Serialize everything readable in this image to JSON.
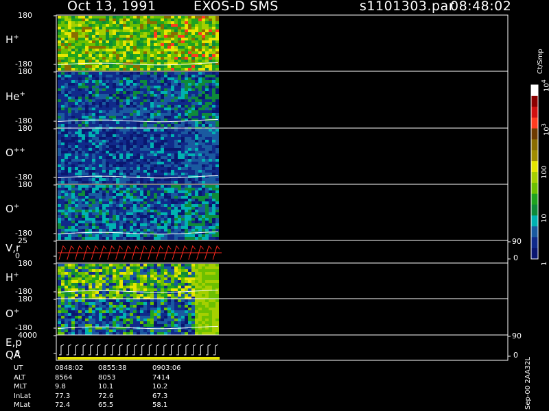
{
  "header": {
    "date": "Oct 13, 1991",
    "instrument": "EXOS-D SMS",
    "file": "s1101303.par",
    "time": "08:48:02"
  },
  "panels": [
    {
      "id": "h_plus_1",
      "label_base": "H",
      "label_sup": "+",
      "y_top": "180",
      "y_bottom": "-180"
    },
    {
      "id": "he_plus",
      "label_base": "He",
      "label_sup": "+",
      "y_top": "180",
      "y_bottom": "-180"
    },
    {
      "id": "o_plusplus",
      "label_base": "O",
      "label_sup": "++",
      "y_top": "180",
      "y_bottom": "-180"
    },
    {
      "id": "o_plus_1",
      "label_base": "O",
      "label_sup": "+",
      "y_top": "180",
      "y_bottom": "-180"
    },
    {
      "id": "vr",
      "label_base": "V,r",
      "label_sup": "",
      "y_top": "25",
      "y_bottom": "0",
      "right_top": "90",
      "right_bottom": "0"
    },
    {
      "id": "h_plus_2",
      "label_base": "H",
      "label_sup": "+",
      "y_top": "180",
      "y_bottom": "-180"
    },
    {
      "id": "o_plus_2",
      "label_base": "O",
      "label_sup": "+",
      "y_top": "180",
      "y_bottom": "-180"
    },
    {
      "id": "ep",
      "label_base": "E,p",
      "label_sup": "",
      "y_top": "4000",
      "y_bottom": "0",
      "right_top": "90",
      "right_bottom": "0",
      "extra_label": "QA"
    }
  ],
  "colorbar": {
    "unit": "Ct/Smp",
    "ticks": [
      {
        "base": "10",
        "sup": "4",
        "value": 10000
      },
      {
        "base": "10",
        "sup": "3",
        "value": 1000
      },
      {
        "base": "100",
        "sup": "",
        "value": 100
      },
      {
        "base": "10",
        "sup": "",
        "value": 10
      },
      {
        "base": "1",
        "sup": "",
        "value": 1
      }
    ],
    "colors": [
      "#ffffff",
      "#8b0000",
      "#d01010",
      "#ff3b1f",
      "#6e3b00",
      "#8a6d00",
      "#a08c00",
      "#e6e600",
      "#a5d000",
      "#6cc000",
      "#1fa31f",
      "#0e8a3a",
      "#00b2b2",
      "#1a5aa0",
      "#102a8a",
      "#0a1670"
    ]
  },
  "ephemeris": {
    "rows": [
      {
        "name": "UT",
        "values": [
          "0848:02",
          "0855:38",
          "0903:06"
        ]
      },
      {
        "name": "ALT",
        "values": [
          "8564",
          "8053",
          "7414"
        ]
      },
      {
        "name": "MLT",
        "values": [
          "9.8",
          "10.1",
          "10.2"
        ]
      },
      {
        "name": "InLat",
        "values": [
          "77.3",
          "72.6",
          "67.3"
        ]
      },
      {
        "name": "MLat",
        "values": [
          "72.4",
          "65.5",
          "58.1"
        ]
      }
    ]
  },
  "footer_note": "Sep-00  2AA32L",
  "chart_data": {
    "type": "heatmap",
    "title": "Oct 13, 1991    EXOS-D SMS",
    "subtitle": "s1101303.par  08:48:02",
    "x_ticks": [
      "0848:02",
      "0855:38",
      "0903:06"
    ],
    "data_coverage_fraction": 0.33,
    "panels": [
      {
        "name": "H+",
        "ylim": [
          -180,
          180
        ]
      },
      {
        "name": "He+",
        "ylim": [
          -180,
          180
        ]
      },
      {
        "name": "O++",
        "ylim": [
          -180,
          180
        ]
      },
      {
        "name": "O+",
        "ylim": [
          -180,
          180
        ]
      },
      {
        "name": "V,r",
        "ylim": [
          0,
          25
        ],
        "ylim_right": [
          0,
          90
        ]
      },
      {
        "name": "H+",
        "ylim": [
          -180,
          180
        ]
      },
      {
        "name": "O+",
        "ylim": [
          -180,
          180
        ]
      },
      {
        "name": "E,p",
        "ylim": [
          0,
          4000
        ],
        "ylim_right": [
          0,
          90
        ]
      }
    ],
    "colorscale": {
      "label": "Ct/Smp",
      "scale": "log",
      "range": [
        1,
        10000
      ]
    }
  }
}
